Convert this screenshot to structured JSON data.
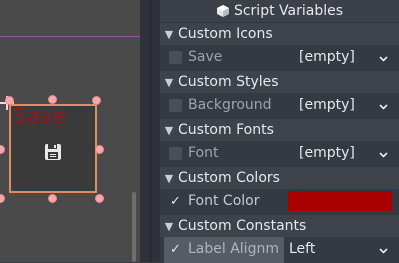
{
  "viewport": {
    "node_label": "Save"
  },
  "inspector": {
    "header_title": "Script Variables",
    "sections": {
      "icons": {
        "title": "Custom Icons"
      },
      "styles": {
        "title": "Custom Styles"
      },
      "fonts": {
        "title": "Custom Fonts"
      },
      "colors": {
        "title": "Custom Colors"
      },
      "constants": {
        "title": "Custom Constants"
      }
    },
    "rows": {
      "save": {
        "label": "Save",
        "value": "[empty]",
        "checked": false
      },
      "background": {
        "label": "Background",
        "value": "[empty]",
        "checked": false
      },
      "font": {
        "label": "Font",
        "value": "[empty]",
        "checked": false
      },
      "font_color": {
        "label": "Font Color",
        "value": "#aa0000",
        "checked": true
      },
      "label_align": {
        "label": "Label Alignm",
        "value": "Left",
        "checked": true
      }
    }
  },
  "icons": {
    "header": "script-icon",
    "section_chevron": "chevron-down-icon",
    "dropdown": "chevron-down-icon",
    "node_icon": "save-icon"
  }
}
